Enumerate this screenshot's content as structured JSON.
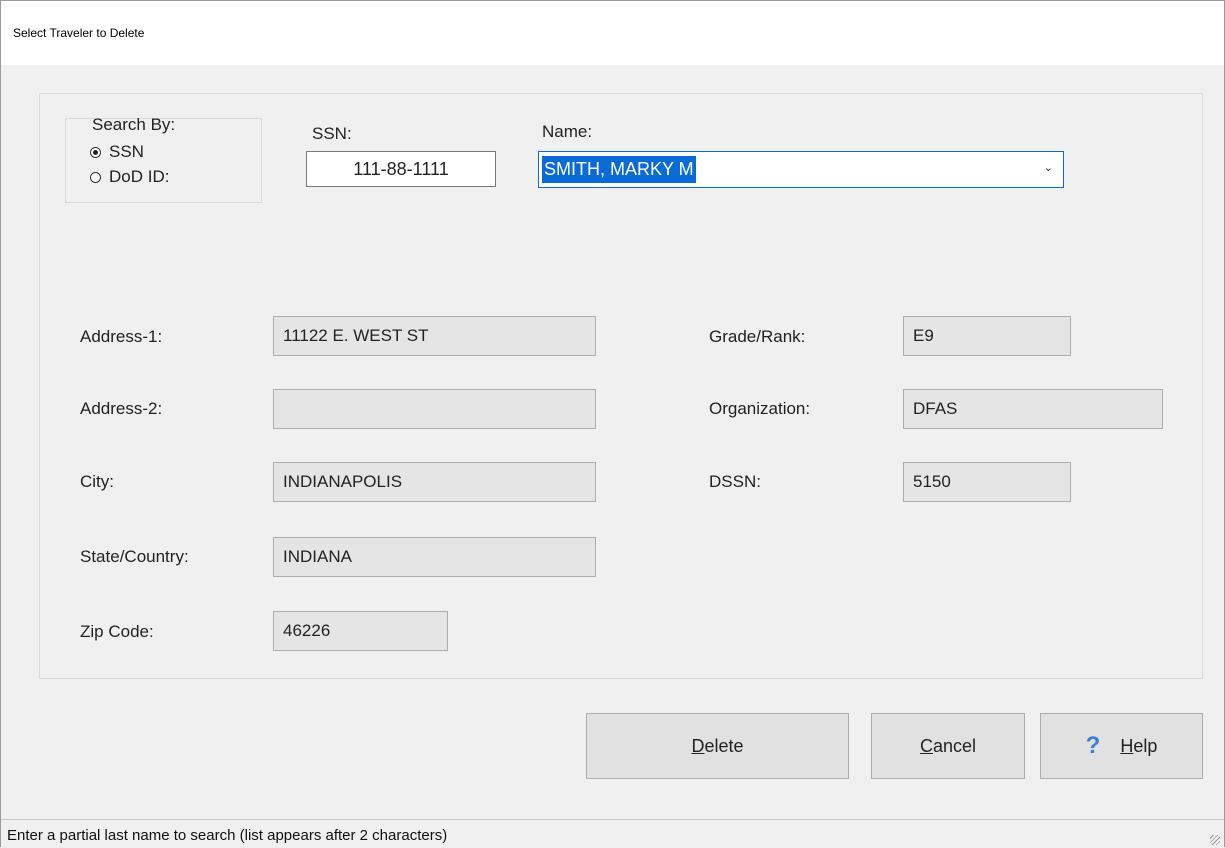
{
  "window": {
    "title": "Select Traveler to Delete"
  },
  "search_by": {
    "label": "Search By:",
    "options": [
      {
        "label": "SSN",
        "checked": true
      },
      {
        "label": "DoD ID:",
        "checked": false
      }
    ]
  },
  "ssn": {
    "label": "SSN:",
    "value": "111-88-1111"
  },
  "name": {
    "label": "Name:",
    "value": "SMITH, MARKY M"
  },
  "fields": {
    "address1": {
      "label": "Address-1:",
      "value": "11122 E. WEST ST"
    },
    "address2": {
      "label": "Address-2:",
      "value": ""
    },
    "city": {
      "label": "City:",
      "value": "INDIANAPOLIS"
    },
    "state": {
      "label": "State/Country:",
      "value": "INDIANA"
    },
    "zip": {
      "label": "Zip Code:",
      "value": "46226"
    },
    "grade": {
      "label": "Grade/Rank:",
      "value": "E9"
    },
    "organization": {
      "label": "Organization:",
      "value": "DFAS"
    },
    "dssn": {
      "label": "DSSN:",
      "value": "5150"
    }
  },
  "buttons": {
    "delete": {
      "mnemonic": "D",
      "rest": "elete"
    },
    "cancel": {
      "mnemonic": "C",
      "rest": "ancel"
    },
    "help": {
      "icon": "?",
      "mnemonic": "H",
      "rest": "elp"
    }
  },
  "status": {
    "text": "Enter a partial last name to search (list appears after 2 characters)"
  }
}
